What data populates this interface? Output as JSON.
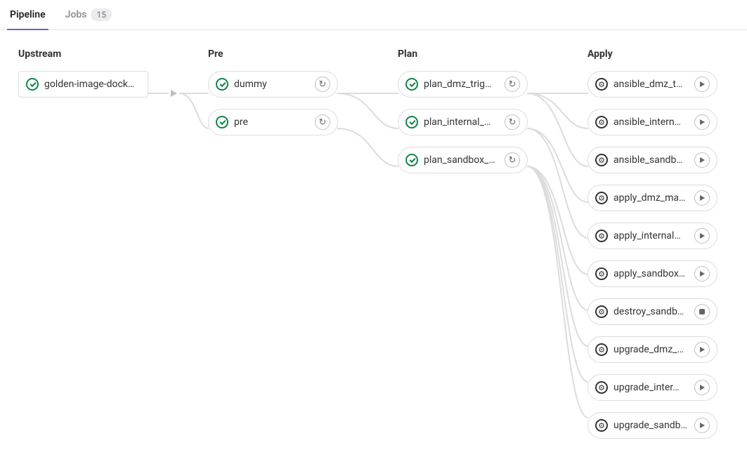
{
  "tabs": {
    "pipeline": "Pipeline",
    "jobs": "Jobs",
    "jobs_count": "15"
  },
  "stages": {
    "upstream": {
      "header": "Upstream",
      "items": [
        {
          "label": "golden-image-dock…",
          "status": "success",
          "action": null
        }
      ]
    },
    "pre": {
      "header": "Pre",
      "items": [
        {
          "label": "dummy",
          "status": "success",
          "action": "retry"
        },
        {
          "label": "pre",
          "status": "success",
          "action": "retry"
        }
      ]
    },
    "plan": {
      "header": "Plan",
      "items": [
        {
          "label": "plan_dmz_trig…",
          "status": "success",
          "action": "retry"
        },
        {
          "label": "plan_internal_…",
          "status": "success",
          "action": "retry"
        },
        {
          "label": "plan_sandbox_…",
          "status": "success",
          "action": "retry"
        }
      ]
    },
    "apply": {
      "header": "Apply",
      "items": [
        {
          "label": "ansible_dmz_t…",
          "status": "manual",
          "action": "play"
        },
        {
          "label": "ansible_intern…",
          "status": "manual",
          "action": "play"
        },
        {
          "label": "ansible_sandb…",
          "status": "manual",
          "action": "play"
        },
        {
          "label": "apply_dmz_ma…",
          "status": "manual",
          "action": "play"
        },
        {
          "label": "apply_internal…",
          "status": "manual",
          "action": "play"
        },
        {
          "label": "apply_sandbox…",
          "status": "manual",
          "action": "play"
        },
        {
          "label": "destroy_sandb…",
          "status": "manual",
          "action": "stop"
        },
        {
          "label": "upgrade_dmz_…",
          "status": "manual",
          "action": "play"
        },
        {
          "label": "upgrade_inter…",
          "status": "manual",
          "action": "play"
        },
        {
          "label": "upgrade_sandb…",
          "status": "manual",
          "action": "play"
        }
      ]
    }
  }
}
